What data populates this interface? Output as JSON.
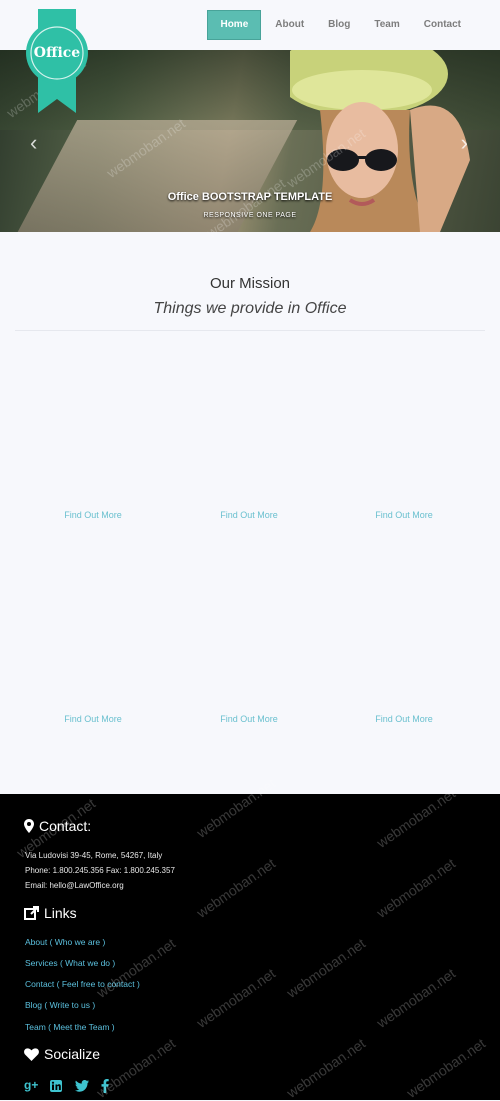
{
  "brand": {
    "logo_text": "Office",
    "badge_color": "#2fc0a6"
  },
  "nav": {
    "items": [
      {
        "label": "Home",
        "active": true
      },
      {
        "label": "About",
        "active": false
      },
      {
        "label": "Blog",
        "active": false
      },
      {
        "label": "Team",
        "active": false
      },
      {
        "label": "Contact",
        "active": false
      }
    ],
    "accent_color": "#5bbdb2"
  },
  "hero": {
    "caption_title": "Office BOOTSTRAP TEMPLATE",
    "caption_subtitle": "RESPONSIVE ONE PAGE",
    "prev_icon": "chevron-left-icon",
    "next_icon": "chevron-right-icon"
  },
  "mission": {
    "title": "Our Mission",
    "subtitle": "Things we provide in Office",
    "links": [
      "Find Out More",
      "Find Out More",
      "Find Out More",
      "Find Out More",
      "Find Out More",
      "Find Out More"
    ]
  },
  "footer": {
    "contact": {
      "heading": "Contact:",
      "icon": "map-marker-icon",
      "address": "Via Ludovisi 39-45, Rome, 54267, Italy",
      "phone": "Phone: 1.800.245.356 Fax: 1.800.245.357",
      "email": "Email: hello@LawOffice.org"
    },
    "links": {
      "heading": "Links",
      "icon": "external-link-icon",
      "items": [
        "About ( Who we are )",
        "Services ( What we do )",
        "Contact ( Feel free to contact )",
        "Blog ( Write to us )",
        "Team ( Meet the Team )"
      ]
    },
    "socialize": {
      "heading": "Socialize",
      "icon": "heart-icon",
      "networks": [
        "google-plus-icon",
        "linkedin-icon",
        "twitter-icon",
        "facebook-icon"
      ],
      "icon_color": "#3ec3cf"
    }
  },
  "watermark": "webmoban.net"
}
